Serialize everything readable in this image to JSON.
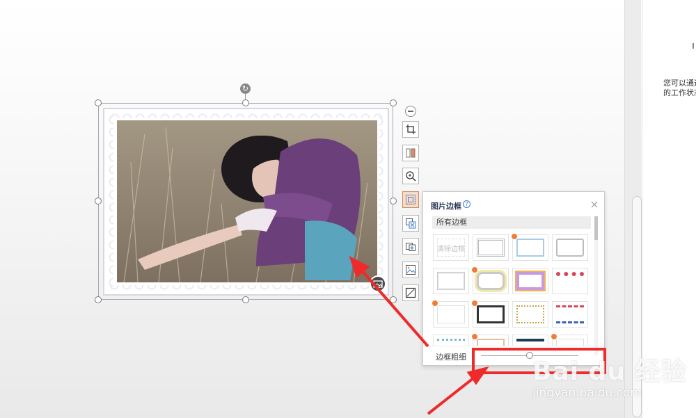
{
  "side_pane": {
    "tip_line1": "您可以通过",
    "tip_line2": "的工作状态"
  },
  "popup": {
    "title": "图片边框",
    "category": "所有边框",
    "clear_label": "清除边框",
    "thickness_label": "边框粗细",
    "thickness_level_percent": 50
  },
  "watermark": {
    "logo": "Bai du 经验",
    "url": "jingyan.baidu.com"
  },
  "colors": {
    "accent_active": "#d08a5e",
    "annotation_red": "#ee2a2a",
    "hot_badge": "#f07c3a"
  },
  "icons": {
    "toolbar": [
      "crop-icon",
      "swap-icon",
      "zoom-icon",
      "frame-icon",
      "translate-icon",
      "picture-add-icon",
      "picture-replace-icon",
      "border-icon"
    ]
  }
}
